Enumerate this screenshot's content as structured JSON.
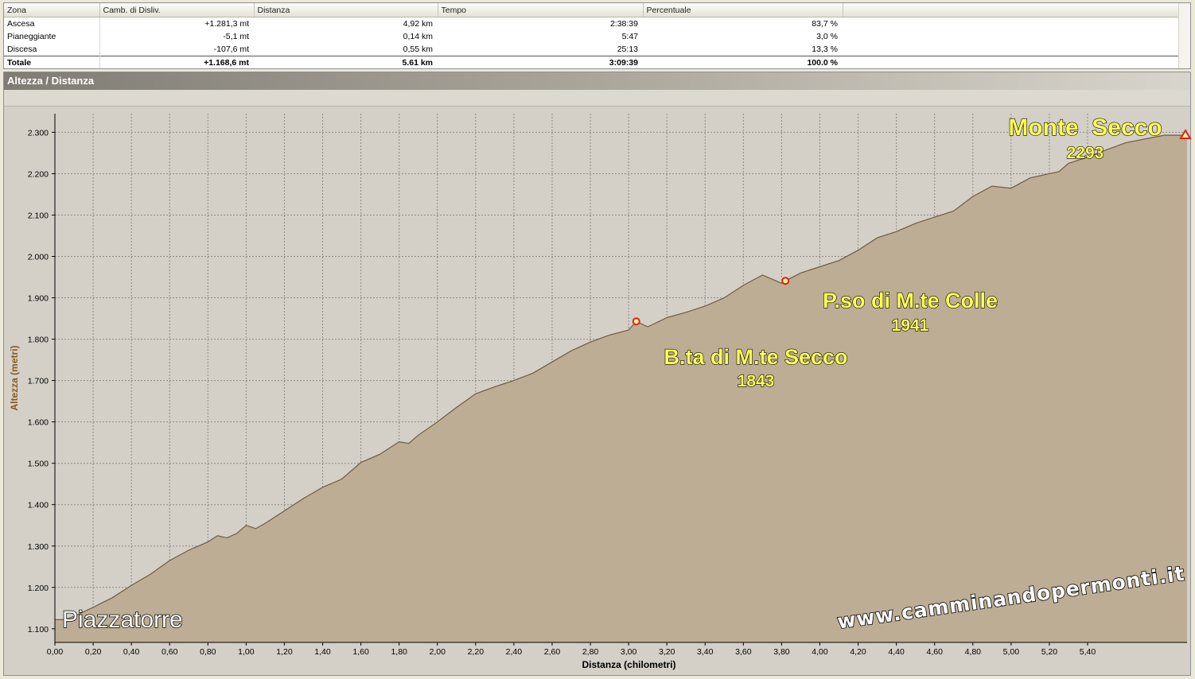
{
  "stats_table": {
    "columns": [
      "Zona",
      "Camb. di Disliv.",
      "Distanza",
      "Tempo",
      "Percentuale"
    ],
    "rows": [
      [
        "Ascesa",
        "+1.281,3 mt",
        "4,92 km",
        "2:38:39",
        "83,7 %"
      ],
      [
        "Pianeggiante",
        "-5,1 mt",
        "0,14 km",
        "5:47",
        "3,0 %"
      ],
      [
        "Discesa",
        "-107,6 mt",
        "0,55 km",
        "25:13",
        "13,3 %"
      ],
      [
        "Totale",
        "+1.168,6 mt",
        "5.61 km",
        "3:09:39",
        "100.0 %"
      ]
    ]
  },
  "panel": {
    "title": "Altezza / Distanza"
  },
  "chart_data": {
    "type": "area",
    "xlabel": "Distanza (chilometri)",
    "ylabel": "Altezza (metri)",
    "xlim": [
      0,
      5.92
    ],
    "ylim": [
      1067,
      2345
    ],
    "grid": true,
    "x_ticks": [
      "0,00",
      "0,20",
      "0,40",
      "0,60",
      "0,80",
      "1,00",
      "1,20",
      "1,40",
      "1,60",
      "1,80",
      "2,00",
      "2,20",
      "2,40",
      "2,60",
      "2,80",
      "3,00",
      "3,20",
      "3,40",
      "3,60",
      "3,80",
      "4,00",
      "4,20",
      "4,40",
      "4,60",
      "4,80",
      "5,00",
      "5,20",
      "5,40"
    ],
    "y_ticks": [
      "1.100",
      "1.200",
      "1.300",
      "1.400",
      "1.500",
      "1.600",
      "1.700",
      "1.800",
      "1.900",
      "2.000",
      "2.100",
      "2.200",
      "2.300"
    ],
    "x": [
      0,
      0.05,
      0.1,
      0.2,
      0.3,
      0.4,
      0.5,
      0.6,
      0.7,
      0.8,
      0.85,
      0.9,
      0.95,
      1.0,
      1.05,
      1.1,
      1.2,
      1.3,
      1.4,
      1.5,
      1.6,
      1.7,
      1.8,
      1.85,
      1.9,
      2.0,
      2.1,
      2.2,
      2.3,
      2.4,
      2.5,
      2.6,
      2.7,
      2.8,
      2.9,
      3.0,
      3.04,
      3.1,
      3.2,
      3.3,
      3.4,
      3.5,
      3.6,
      3.7,
      3.75,
      3.8,
      3.82,
      3.9,
      4.0,
      4.1,
      4.2,
      4.3,
      4.4,
      4.5,
      4.6,
      4.7,
      4.8,
      4.9,
      5.0,
      5.1,
      5.2,
      5.25,
      5.3,
      5.4,
      5.5,
      5.6,
      5.8,
      5.92
    ],
    "values": [
      1122,
      1122,
      1130,
      1152,
      1175,
      1205,
      1232,
      1265,
      1290,
      1310,
      1325,
      1320,
      1330,
      1350,
      1342,
      1355,
      1385,
      1415,
      1442,
      1462,
      1502,
      1522,
      1552,
      1548,
      1568,
      1600,
      1635,
      1668,
      1685,
      1700,
      1718,
      1745,
      1772,
      1793,
      1810,
      1822,
      1843,
      1830,
      1852,
      1865,
      1880,
      1900,
      1930,
      1955,
      1945,
      1935,
      1941,
      1960,
      1975,
      1990,
      2015,
      2045,
      2060,
      2080,
      2095,
      2110,
      2145,
      2170,
      2165,
      2190,
      2200,
      2205,
      2225,
      2240,
      2258,
      2275,
      2293,
      2293
    ],
    "annotations": [
      {
        "name": "Piazzatorre",
        "elevation": "",
        "x": 0.0,
        "y": 1122,
        "marker": "none"
      },
      {
        "name": "B.ta di M.te Secco",
        "elevation": "1843",
        "x": 3.04,
        "y": 1843,
        "marker": "circle"
      },
      {
        "name": "P.so di M.te Colle",
        "elevation": "1941",
        "x": 3.82,
        "y": 1941,
        "marker": "circle"
      },
      {
        "name": "Monte  Secco",
        "elevation": "2293",
        "x": 5.92,
        "y": 2293,
        "marker": "triangle"
      }
    ],
    "watermark": "www.camminandopermonti.it",
    "colors": {
      "fill": "#bcad94",
      "line": "#6f5c40",
      "marker": "#e0201a",
      "label_fill": "#ffff55"
    }
  }
}
